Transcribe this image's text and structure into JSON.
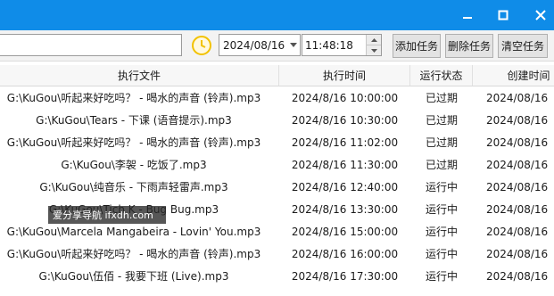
{
  "colors": {
    "titlebar": "#0f8ce8",
    "clock_icon": "#f2c200"
  },
  "toolbar": {
    "date_value": "2024/08/16",
    "time_value": "11:48:18",
    "add_task_label": "添加任务",
    "delete_task_label": "删除任务",
    "clear_tasks_label": "清空任务"
  },
  "table": {
    "columns": [
      "执行文件",
      "执行时间",
      "运行状态",
      "创建时间"
    ],
    "rows": [
      [
        "G:\\KuGou\\听起来好吃吗？ - 喝水的声音 (铃声).mp3",
        "2024/8/16 10:00:00",
        "已过期",
        "2024/08/16"
      ],
      [
        "G:\\KuGou\\Tears - 下课 (语音提示).mp3",
        "2024/8/16 10:30:00",
        "已过期",
        "2024/08/16"
      ],
      [
        "G:\\KuGou\\听起来好吃吗？ - 喝水的声音 (铃声).mp3",
        "2024/8/16 11:02:00",
        "已过期",
        "2024/08/16"
      ],
      [
        "G:\\KuGou\\李袈 - 吃饭了.mp3",
        "2024/8/16 11:30:00",
        "已过期",
        "2024/08/16"
      ],
      [
        "G:\\KuGou\\纯音乐 - 下雨声轻雷声.mp3",
        "2024/8/16 12:40:00",
        "运行中",
        "2024/08/16"
      ],
      [
        "G:\\KuGou\\Tich K - Bug Bug.mp3",
        "2024/8/16 13:30:00",
        "运行中",
        "2024/08/16"
      ],
      [
        "G:\\KuGou\\Marcela Mangabeira - Lovin' You.mp3",
        "2024/8/16 15:00:00",
        "运行中",
        "2024/08/16"
      ],
      [
        "G:\\KuGou\\听起来好吃吗？ - 喝水的声音 (铃声).mp3",
        "2024/8/16 16:00:00",
        "运行中",
        "2024/08/16"
      ],
      [
        "G:\\KuGou\\伍佰 - 我要下班 (Live).mp3",
        "2024/8/16 17:30:00",
        "运行中",
        "2024/08/16"
      ]
    ]
  },
  "watermark": {
    "text": "爱分享导航 ifxdh.com"
  }
}
